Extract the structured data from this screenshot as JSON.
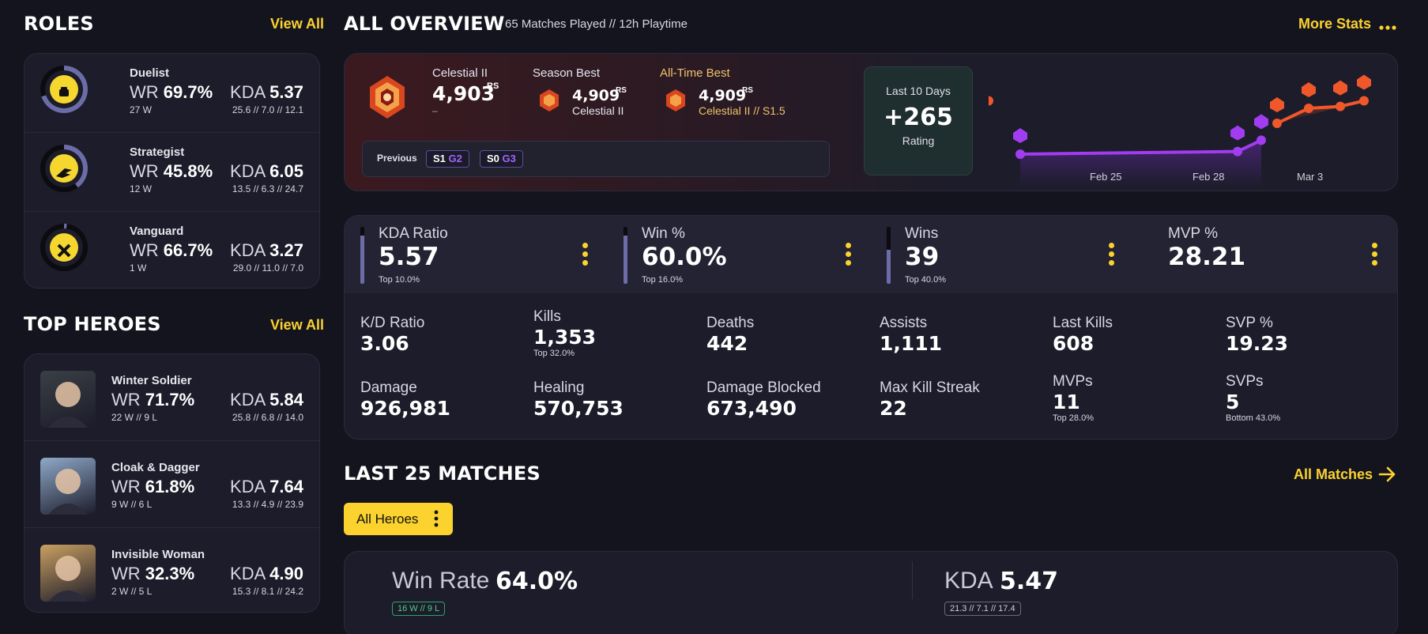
{
  "roles": {
    "title": "ROLES",
    "view_all": "View All",
    "items": [
      {
        "name": "Duelist",
        "wr_label": "WR",
        "wr": "69.7%",
        "wins": "27 W",
        "kda_label": "KDA",
        "kda": "5.37",
        "kda_detail": "25.6 // 7.0 // 12.1",
        "icon": "fist-icon",
        "share": 0.7
      },
      {
        "name": "Strategist",
        "wr_label": "WR",
        "wr": "45.8%",
        "wins": "12 W",
        "kda_label": "KDA",
        "kda": "6.05",
        "kda_detail": "13.5 // 6.3 // 24.7",
        "icon": "wing-icon",
        "share": 0.4
      },
      {
        "name": "Vanguard",
        "wr_label": "WR",
        "wr": "66.7%",
        "wins": "1 W",
        "kda_label": "KDA",
        "kda": "3.27",
        "kda_detail": "29.0 // 11.0 // 7.0",
        "icon": "shield-cross-icon",
        "share": 0.02
      }
    ]
  },
  "heroes": {
    "title": "TOP HEROES",
    "view_all": "View All",
    "items": [
      {
        "name": "Winter Soldier",
        "wr_label": "WR",
        "wr": "71.7%",
        "record": "22 W // 9 L",
        "kda_label": "KDA",
        "kda": "5.84",
        "kda_detail": "25.8 // 6.8 // 14.0",
        "color": "#3a3f45"
      },
      {
        "name": "Cloak & Dagger",
        "wr_label": "WR",
        "wr": "61.8%",
        "record": "9 W // 6 L",
        "kda_label": "KDA",
        "kda": "7.64",
        "kda_detail": "13.3 // 4.9 // 23.9",
        "color": "#8fa9c9"
      },
      {
        "name": "Invisible Woman",
        "wr_label": "WR",
        "wr": "32.3%",
        "record": "2 W // 5 L",
        "kda_label": "KDA",
        "kda": "4.90",
        "kda_detail": "15.3 // 8.1 // 24.2",
        "color": "#c9a062"
      }
    ]
  },
  "overview": {
    "title": "ALL OVERVIEW",
    "subtitle": "65 Matches Played // 12h Playtime",
    "more_stats": "More Stats",
    "current_rank": "Celestial II",
    "current_rating": "4,903",
    "rs": "RS",
    "current_dash": "–",
    "season_best_label": "Season Best",
    "season_best_rating": "4,909",
    "season_best_rank": "Celestial II",
    "alltime_label": "All-Time Best",
    "alltime_rating": "4,909",
    "alltime_rank": "Celestial II // S1.5",
    "previous_label": "Previous",
    "previous": [
      {
        "season": "S1",
        "rank": "G2"
      },
      {
        "season": "S0",
        "rank": "G3"
      }
    ],
    "last10_label": "Last 10 Days",
    "last10_value": "+265",
    "last10_unit": "Rating"
  },
  "chart_data": {
    "type": "line",
    "x_ticks": [
      "Feb 25",
      "Feb 28",
      "Mar 3"
    ],
    "series": [
      {
        "color": "#a23cf0",
        "points": [
          [
            0,
            4638
          ],
          [
            1,
            4645
          ],
          [
            2,
            4675
          ]
        ]
      },
      {
        "color": "#f0572a",
        "points": [
          [
            2,
            4720
          ],
          [
            3,
            4760
          ],
          [
            4,
            4765
          ],
          [
            5,
            4780
          ],
          [
            6,
            4780
          ]
        ]
      }
    ]
  },
  "top_stats": [
    {
      "label": "KDA Ratio",
      "value": "5.57",
      "sub": "Top 10.0%",
      "fill": 0.85
    },
    {
      "label": "Win %",
      "value": "60.0%",
      "sub": "Top 16.0%",
      "fill": 0.85
    },
    {
      "label": "Wins",
      "value": "39",
      "sub": "Top 40.0%",
      "fill": 0.6
    },
    {
      "label": "MVP %",
      "value": "28.21",
      "sub": "",
      "fill": 0
    }
  ],
  "grid_stats": [
    {
      "label": "K/D Ratio",
      "value": "3.06",
      "sub": ""
    },
    {
      "label": "Kills",
      "value": "1,353",
      "sub": "Top 32.0%"
    },
    {
      "label": "Deaths",
      "value": "442",
      "sub": ""
    },
    {
      "label": "Assists",
      "value": "1,111",
      "sub": ""
    },
    {
      "label": "Last Kills",
      "value": "608",
      "sub": ""
    },
    {
      "label": "SVP %",
      "value": "19.23",
      "sub": ""
    },
    {
      "label": "Damage",
      "value": "926,981",
      "sub": ""
    },
    {
      "label": "Healing",
      "value": "570,753",
      "sub": ""
    },
    {
      "label": "Damage Blocked",
      "value": "673,490",
      "sub": ""
    },
    {
      "label": "Max Kill Streak",
      "value": "22",
      "sub": ""
    },
    {
      "label": "MVPs",
      "value": "11",
      "sub": "Top 28.0%"
    },
    {
      "label": "SVPs",
      "value": "5",
      "sub": "Bottom 43.0%"
    }
  ],
  "matches": {
    "title": "LAST 25 MATCHES",
    "all_matches": "All Matches",
    "filter": "All Heroes",
    "winrate_label": "Win Rate",
    "winrate": "64.0%",
    "record": "16 W // 9 L",
    "kda_label": "KDA",
    "kda": "5.47",
    "kda_detail": "21.3 // 7.1 // 17.4"
  }
}
